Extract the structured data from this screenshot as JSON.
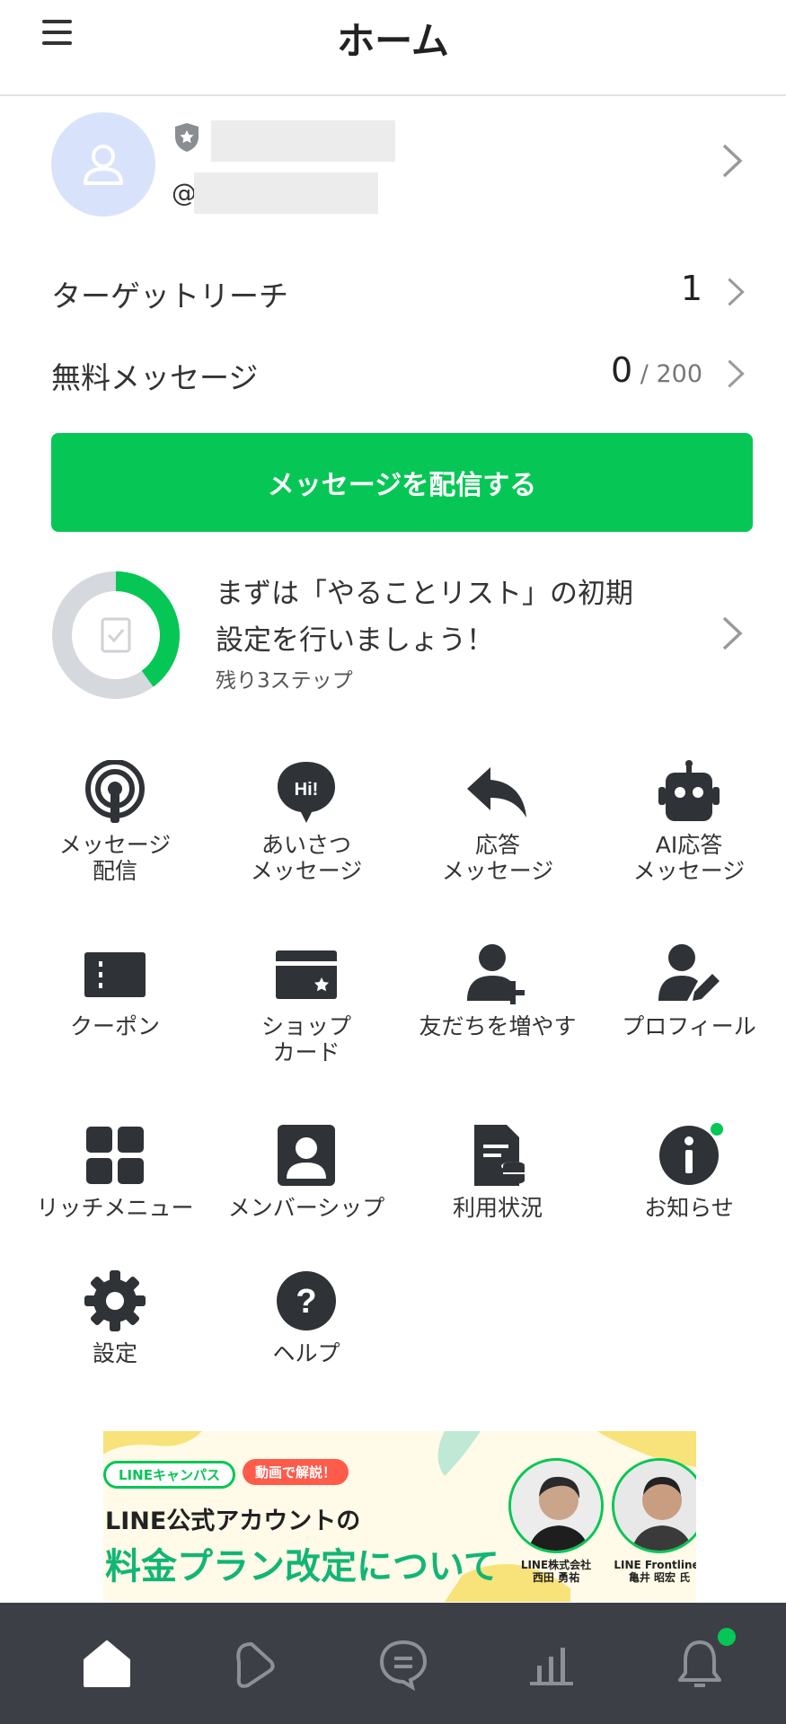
{
  "header": {
    "title": "ホーム"
  },
  "account": {
    "at_prefix": "@"
  },
  "stats": [
    {
      "label": "ターゲットリーチ",
      "value": "1",
      "suffix": ""
    },
    {
      "label": "無料メッセージ",
      "value": "0",
      "suffix": " / 200"
    }
  ],
  "cta": {
    "label": "メッセージを配信する"
  },
  "todo": {
    "title_line1": "まずは「やることリスト」の初期",
    "title_line2": "設定を行いましょう！",
    "remaining": "残り3ステップ",
    "progress": 0.4
  },
  "menu": [
    {
      "label": "メッセージ\n配信",
      "icon": "broadcast-icon"
    },
    {
      "label": "あいさつ\nメッセージ",
      "icon": "hi-bubble-icon"
    },
    {
      "label": "応答\nメッセージ",
      "icon": "reply-icon"
    },
    {
      "label": "AI応答\nメッセージ",
      "icon": "robot-icon"
    },
    {
      "label": "クーポン",
      "icon": "coupon-icon"
    },
    {
      "label": "ショップ\nカード",
      "icon": "shop-card-icon"
    },
    {
      "label": "友だちを増やす",
      "icon": "add-friend-icon"
    },
    {
      "label": "プロフィール",
      "icon": "profile-edit-icon"
    },
    {
      "label": "リッチメニュー",
      "icon": "rich-menu-icon"
    },
    {
      "label": "メンバーシップ",
      "icon": "membership-icon"
    },
    {
      "label": "利用状況",
      "icon": "usage-icon"
    },
    {
      "label": "お知らせ",
      "icon": "info-icon"
    },
    {
      "label": "設定",
      "icon": "gear-icon"
    },
    {
      "label": "ヘルプ",
      "icon": "help-icon"
    }
  ],
  "banner": {
    "tag1": "LINEキャンパス",
    "tag2": "動画で解説！",
    "line1": "LINE公式アカウントの",
    "line2": "料金プラン改定について",
    "person1_org": "LINE株式会社",
    "person1_name": "西田 勇祐",
    "person2_org": "LINE Frontliner",
    "person2_name": "亀井 昭宏 氏"
  },
  "tabs": [
    "home-icon",
    "voom-icon",
    "chat-icon",
    "analytics-icon",
    "notifications-icon"
  ],
  "colors": {
    "brand_green": "#06c755",
    "tabbar": "#3c4046",
    "icon_dark": "#2f3337"
  }
}
